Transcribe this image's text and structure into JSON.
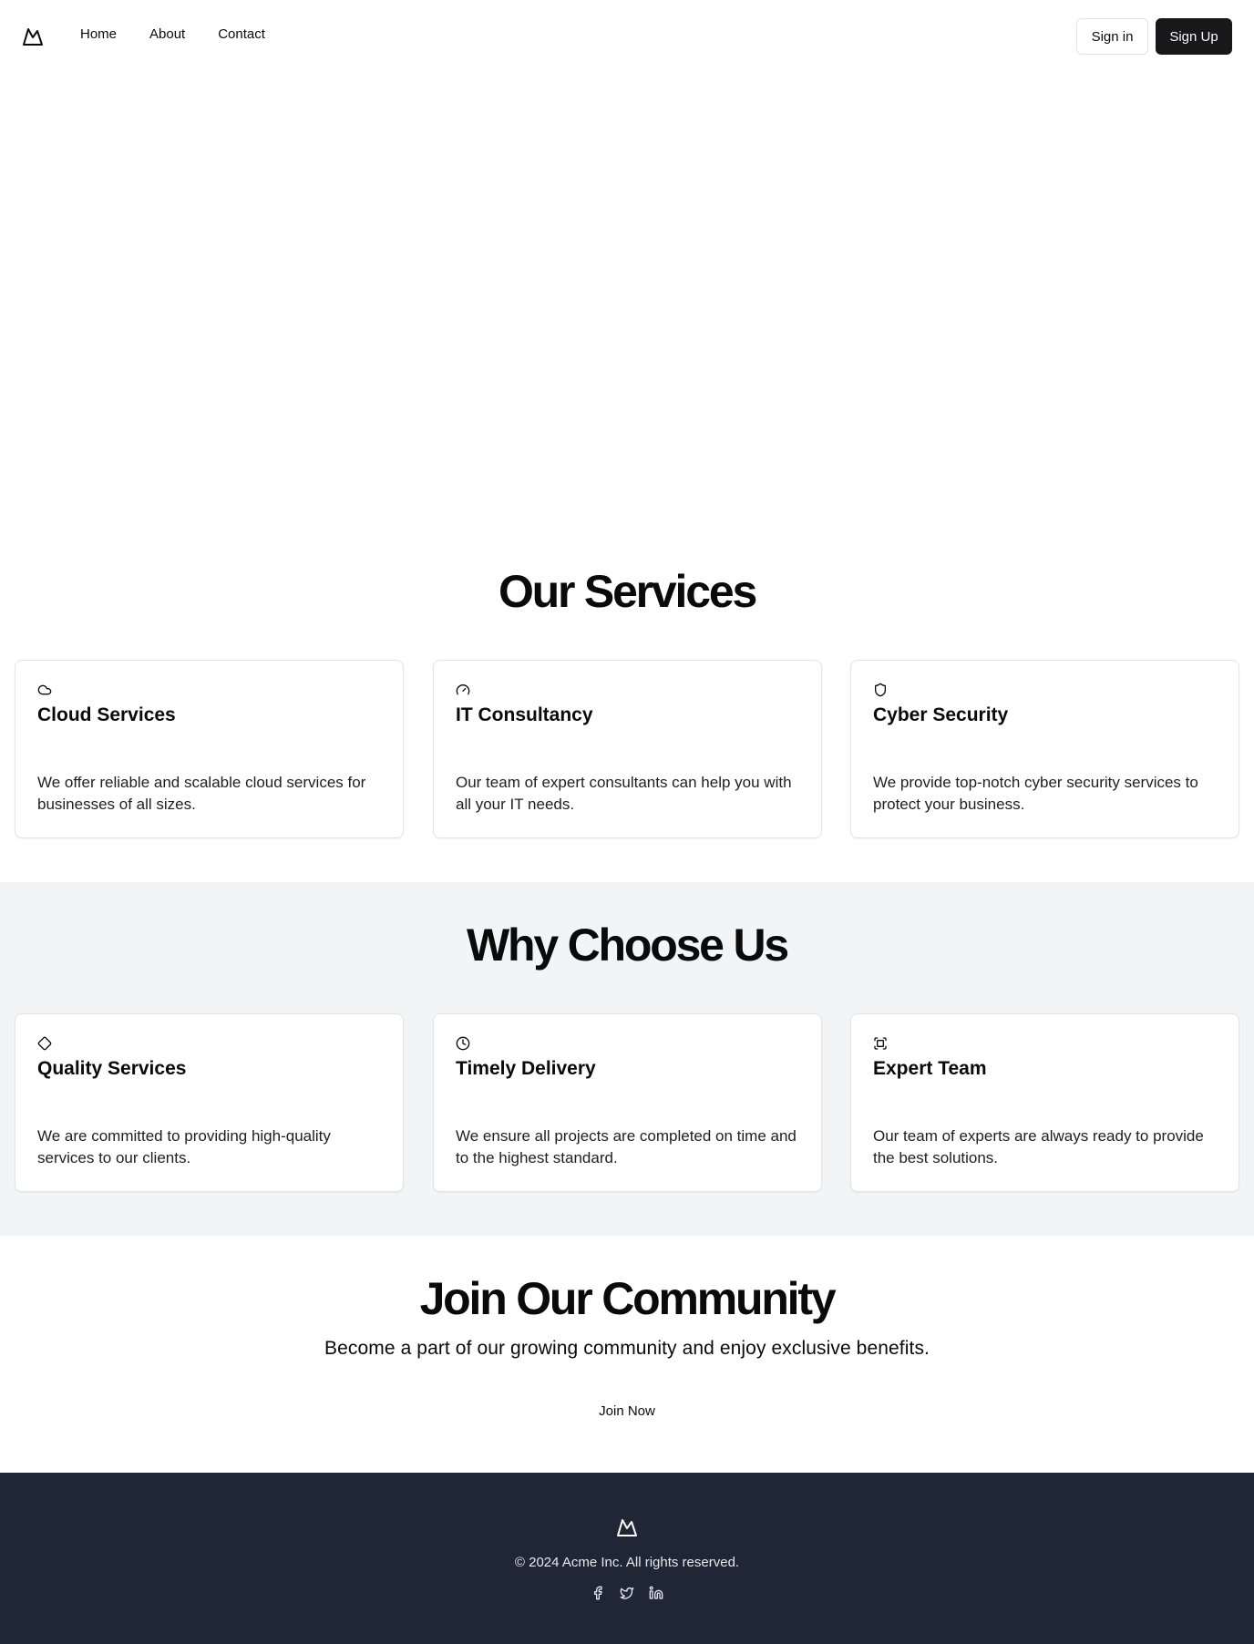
{
  "nav": {
    "logo_icon": "mountain-icon",
    "links": [
      "Home",
      "About",
      "Contact"
    ],
    "signin_label": "Sign in",
    "signup_label": "Sign Up"
  },
  "services": {
    "title": "Our Services",
    "cards": [
      {
        "icon": "cloud-icon",
        "title": "Cloud Services",
        "text": "We offer reliable and scalable cloud services for businesses of all sizes."
      },
      {
        "icon": "gauge-icon",
        "title": "IT Consultancy",
        "text": "Our team of expert consultants can help you with all your IT needs."
      },
      {
        "icon": "shield-icon",
        "title": "Cyber Security",
        "text": "We provide top-notch cyber security services to protect your business."
      }
    ]
  },
  "why": {
    "title": "Why Choose Us",
    "cards": [
      {
        "icon": "diamond-icon",
        "title": "Quality Services",
        "text": "We are committed to providing high-quality services to our clients."
      },
      {
        "icon": "clock-icon",
        "title": "Timely Delivery",
        "text": "We ensure all projects are completed on time and to the highest standard."
      },
      {
        "icon": "scan-face-icon",
        "title": "Expert Team",
        "text": "Our team of experts are always ready to provide the best solutions."
      }
    ]
  },
  "community": {
    "title": "Join Our Community",
    "subtitle": "Become a part of our growing community and enjoy exclusive benefits.",
    "button_label": "Join Now"
  },
  "footer": {
    "logo_icon": "mountain-icon",
    "copyright": "© 2024 Acme Inc. All rights reserved.",
    "social_icons": [
      "facebook-icon",
      "twitter-icon",
      "linkedin-icon"
    ]
  },
  "colors": {
    "primary_button": "#18181b",
    "section_bg": "#f2f4f6",
    "footer_bg": "#1f2737"
  }
}
